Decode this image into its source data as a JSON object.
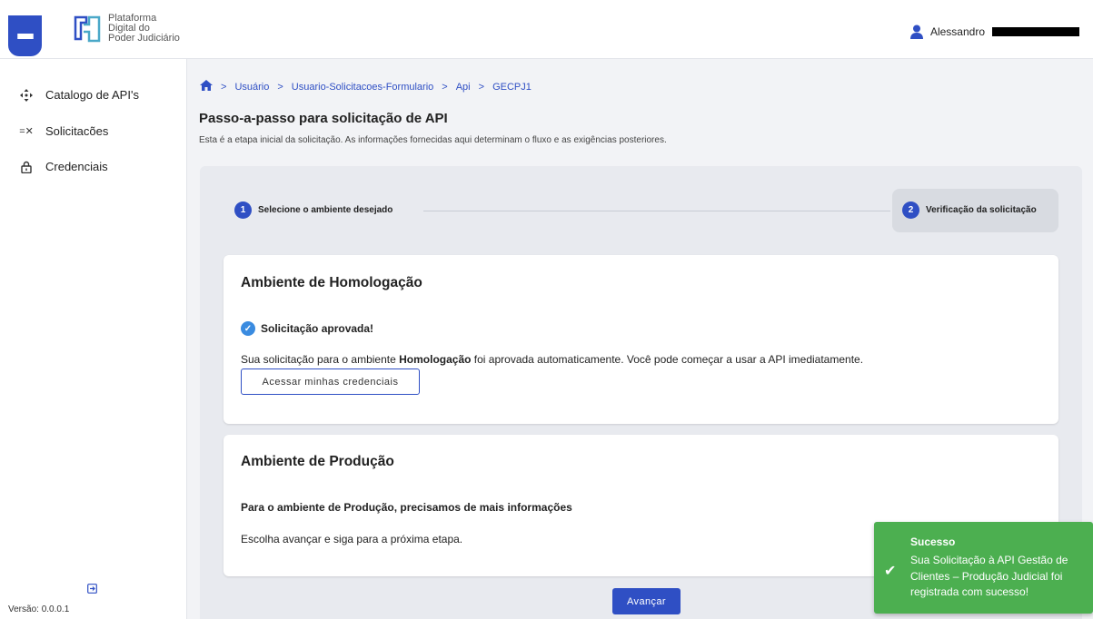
{
  "header": {
    "logo_lines": [
      "Plataforma",
      "Digital do",
      "Poder Judiciário"
    ],
    "user_name": "Alessandro",
    "menu_icon": "hamburger-icon",
    "user_icon": "person-icon"
  },
  "sidebar": {
    "items": [
      {
        "label": "Catalogo de API's",
        "icon": "move-arrows-icon"
      },
      {
        "label": "Solicitacões",
        "icon": "list-check-icon"
      },
      {
        "label": "Credenciais",
        "icon": "lock-icon"
      }
    ],
    "version": "Versão: 0.0.0.1"
  },
  "breadcrumb": {
    "items": [
      "Usuário",
      "Usuario-Solicitacoes-Formulario",
      "Api",
      "GECPJ1"
    ],
    "separator": ">"
  },
  "page": {
    "title": "Passo-a-passo para solicitação de API",
    "subtitle": "Esta é a etapa inicial da solicitação. As informações fornecidas aqui determinam o fluxo e as exigências posteriores."
  },
  "stepper": {
    "steps": [
      {
        "number": "1",
        "label": "Selecione o ambiente desejado"
      },
      {
        "number": "2",
        "label": "Verificação da solicitação"
      }
    ],
    "active_step": 2
  },
  "homologacao": {
    "title": "Ambiente de Homologação",
    "status": "Solicitação aprovada!",
    "text_before": "Sua solicitação para o ambiente ",
    "text_bold": "Homologação",
    "text_after": " foi aprovada automaticamente. Você pode começar a usar a API imediatamente.",
    "button": "Acessar minhas credenciais"
  },
  "producao": {
    "title": "Ambiente de Produção",
    "subtitle": "Para o ambiente de Produção, precisamos de mais informações",
    "text": "Escolha avançar e siga para a próxima etapa."
  },
  "actions": {
    "next": "Avançar"
  },
  "toast": {
    "title": "Sucesso",
    "message": "Sua Solicitação à API Gestão de Clientes – Produção Judicial foi registrada com sucesso!"
  },
  "colors": {
    "primary": "#2f4fc4",
    "success": "#4caf50",
    "check": "#3a8be0"
  }
}
